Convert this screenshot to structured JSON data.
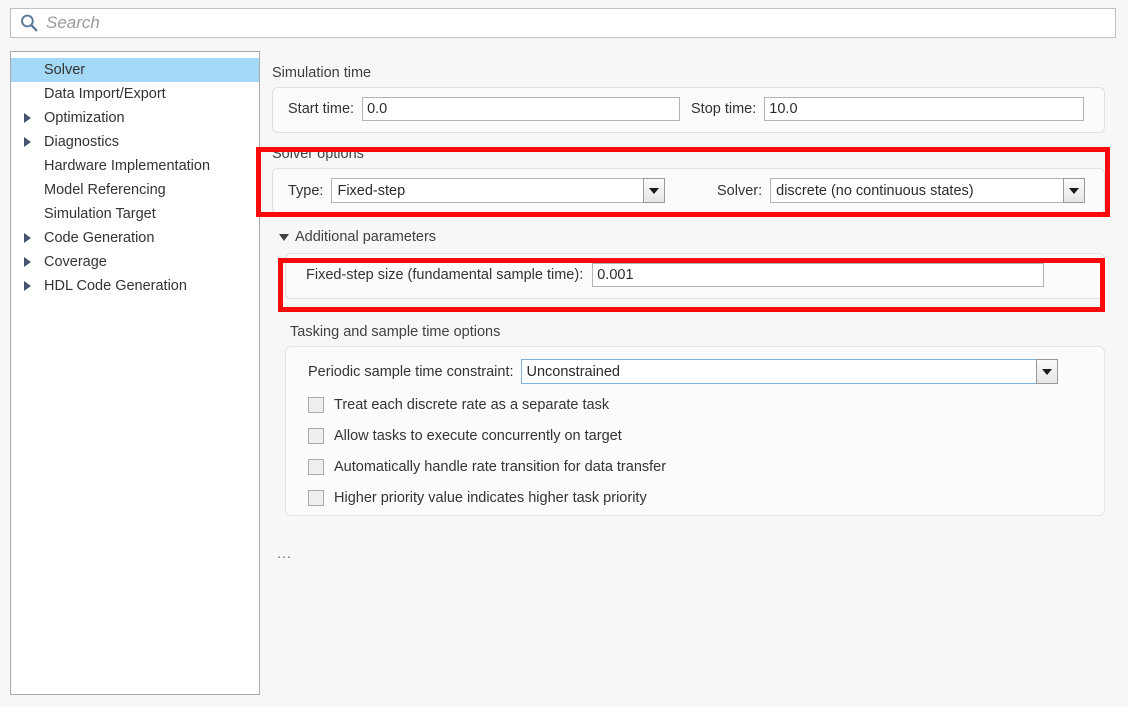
{
  "search": {
    "placeholder": "Search",
    "value": "",
    "icon": "search-icon"
  },
  "sidebar": {
    "items": [
      {
        "label": "Solver",
        "expandable": false,
        "selected": true
      },
      {
        "label": "Data Import/Export",
        "expandable": false,
        "selected": false
      },
      {
        "label": "Optimization",
        "expandable": true,
        "selected": false
      },
      {
        "label": "Diagnostics",
        "expandable": true,
        "selected": false
      },
      {
        "label": "Hardware Implementation",
        "expandable": false,
        "selected": false
      },
      {
        "label": "Model Referencing",
        "expandable": false,
        "selected": false
      },
      {
        "label": "Simulation Target",
        "expandable": false,
        "selected": false
      },
      {
        "label": "Code Generation",
        "expandable": true,
        "selected": false
      },
      {
        "label": "Coverage",
        "expandable": true,
        "selected": false
      },
      {
        "label": "HDL Code Generation",
        "expandable": true,
        "selected": false
      }
    ]
  },
  "simulation_time": {
    "title": "Simulation time",
    "start_label": "Start time:",
    "start_value": "0.0",
    "stop_label": "Stop time:",
    "stop_value": "10.0"
  },
  "solver_options": {
    "title": "Solver options",
    "type_label": "Type:",
    "type_value": "Fixed-step",
    "solver_label": "Solver:",
    "solver_value": "discrete (no continuous states)"
  },
  "additional_parameters": {
    "title": "Additional parameters",
    "fixed_step_label": "Fixed-step size (fundamental sample time):",
    "fixed_step_value": "0.001"
  },
  "tasking": {
    "title": "Tasking and sample time options",
    "constraint_label": "Periodic sample time constraint:",
    "constraint_value": "Unconstrained",
    "checkboxes": [
      {
        "label": "Treat each discrete rate as a separate task",
        "checked": false
      },
      {
        "label": "Allow tasks to execute concurrently on target",
        "checked": false
      },
      {
        "label": "Automatically handle rate transition for data transfer",
        "checked": false
      },
      {
        "label": "Higher priority value indicates higher task priority",
        "checked": false
      }
    ]
  },
  "footer": {
    "ellipsis": "..."
  },
  "colors": {
    "highlight": "#fa0a0a",
    "selection": "#a3d8f6",
    "search_icon": "#5a7a9a",
    "background": "#f7f7f7"
  }
}
